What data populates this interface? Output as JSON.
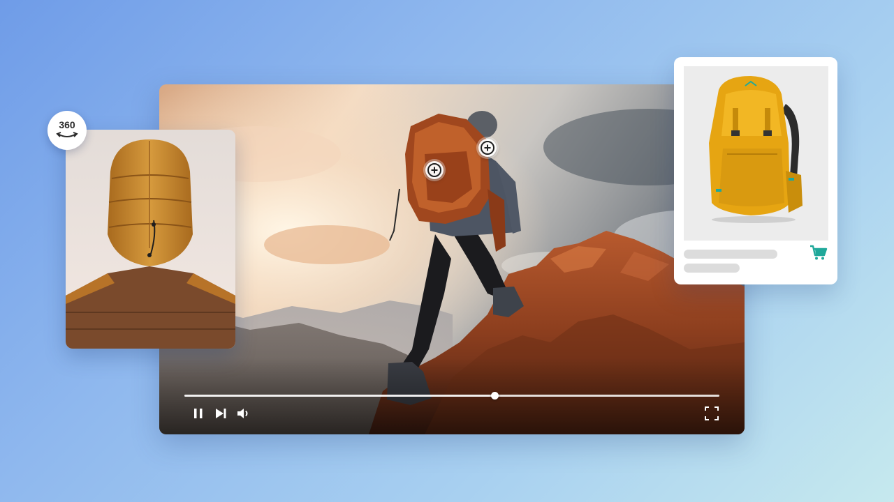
{
  "badge": {
    "label": "360",
    "icon": "rotate-360-icon"
  },
  "player": {
    "progress_fraction": 0.58,
    "buffered_fraction": 0.58,
    "controls": {
      "pause_icon": "pause-icon",
      "next_icon": "skip-next-icon",
      "volume_icon": "volume-icon",
      "fullscreen_icon": "fullscreen-icon"
    },
    "hotspots": [
      {
        "name": "hotspot-backpack",
        "icon": "plus-circle-icon"
      },
      {
        "name": "hotspot-jacket",
        "icon": "plus-circle-icon"
      }
    ]
  },
  "product_card": {
    "image": "yellow-backpack",
    "cart_icon": "shopping-cart-icon",
    "accent_color": "#1fa89a"
  },
  "colors": {
    "background_start": "#6f9ce8",
    "background_end": "#c6e9ee",
    "skeleton": "#dcdcdc"
  }
}
